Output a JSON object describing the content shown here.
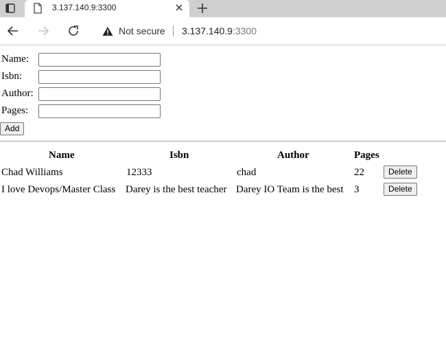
{
  "browser": {
    "tab_title": "3.137.140.9:3300",
    "security_label": "Not secure",
    "url_host": "3.137.140.9",
    "url_port": ":3300"
  },
  "form": {
    "name_label": "Name:",
    "isbn_label": "Isbn:",
    "author_label": "Author:",
    "pages_label": "Pages:",
    "name_value": "",
    "isbn_value": "",
    "author_value": "",
    "pages_value": "",
    "add_label": "Add"
  },
  "table": {
    "headers": [
      "Name",
      "Isbn",
      "Author",
      "Pages"
    ],
    "rows": [
      {
        "name": "Chad Williams",
        "isbn": "12333",
        "author": "chad",
        "pages": "22",
        "action": "Delete"
      },
      {
        "name": "I love Devops/Master Class",
        "isbn": "Darey is the best teacher",
        "author": "Darey IO Team is the best",
        "pages": "3",
        "action": "Delete"
      }
    ]
  }
}
